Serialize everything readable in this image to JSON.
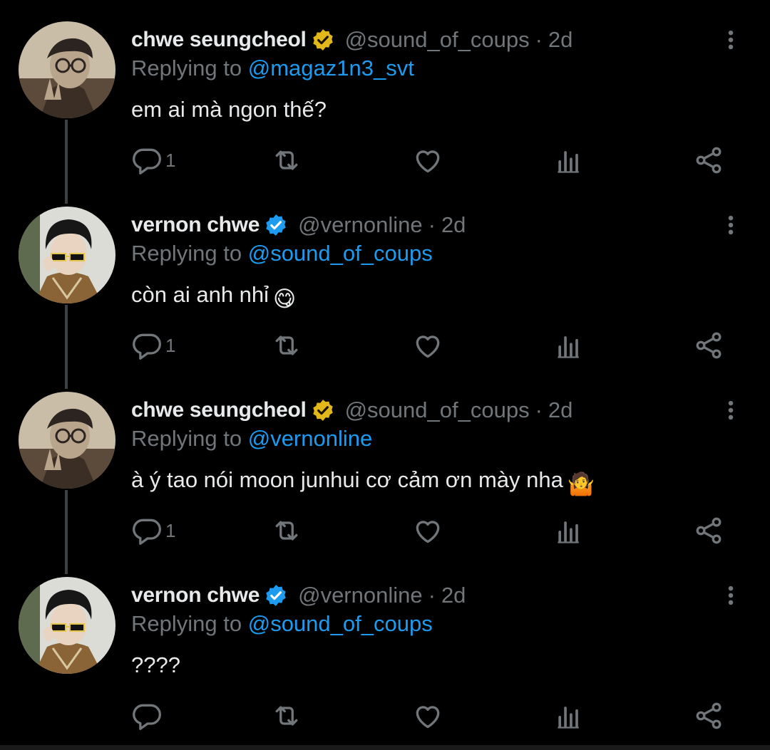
{
  "colors": {
    "background": "#000000",
    "text": "#e7e9ea",
    "muted": "#71767b",
    "link": "#1d9bf0",
    "gold_badge": "#e2b719",
    "blue_badge": "#1d9bf0"
  },
  "replying_prefix": "Replying to",
  "tweets": [
    {
      "name": "chwe seungcheol",
      "badge": "gold-verified-icon",
      "handle": "@sound_of_coups",
      "dot": "·",
      "time": "2d",
      "reply_to": "@magaz1n3_svt",
      "text": "em ai mà ngon thế?",
      "emoji": "",
      "reply_count": "1"
    },
    {
      "name": "vernon chwe",
      "badge": "blue-verified-icon",
      "handle": "@vernonline",
      "dot": "·",
      "time": "2d",
      "reply_to": "@sound_of_coups",
      "text": "còn ai anh nhỉ",
      "emoji": "😋",
      "reply_count": "1"
    },
    {
      "name": "chwe seungcheol",
      "badge": "gold-verified-icon",
      "handle": "@sound_of_coups",
      "dot": "·",
      "time": "2d",
      "reply_to": "@vernonline",
      "text": "à ý tao nói moon junhui cơ cảm ơn mày nha",
      "emoji": "🤷",
      "reply_count": "1"
    },
    {
      "name": "vernon chwe",
      "badge": "blue-verified-icon",
      "handle": "@vernonline",
      "dot": "·",
      "time": "2d",
      "reply_to": "@sound_of_coups",
      "text": "????",
      "emoji": "",
      "reply_count": ""
    }
  ]
}
